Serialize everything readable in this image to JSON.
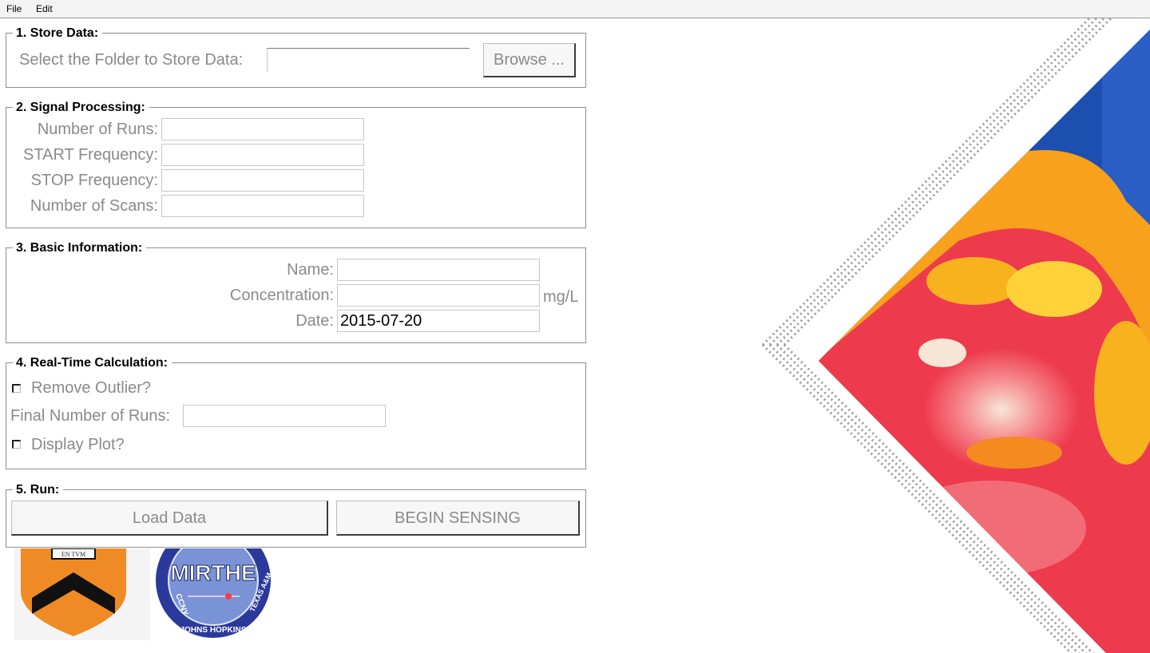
{
  "menu": {
    "file": "File",
    "edit": "Edit"
  },
  "store": {
    "legend": "1. Store Data:",
    "folder_label": "Select the Folder to Store Data:",
    "folder_value": "",
    "browse_label": "Browse ..."
  },
  "signal": {
    "legend": "2. Signal Processing:",
    "runs_label": "Number of Runs:",
    "start_label": "START Frequency:",
    "stop_label": "STOP Frequency:",
    "scans_label": "Number of Scans:",
    "runs_value": "",
    "start_value": "",
    "stop_value": "",
    "scans_value": ""
  },
  "basic": {
    "legend": "3. Basic Information:",
    "name_label": "Name:",
    "conc_label": "Concentration:",
    "date_label": "Date:",
    "name_value": "",
    "conc_value": "",
    "date_value": "2015-07-20",
    "unit": "mg/L"
  },
  "realtime": {
    "legend": "4. Real-Time Calculation:",
    "outlier_label": "Remove Outlier?",
    "final_runs_label": "Final Number of Runs:",
    "final_runs_value": "",
    "plot_label": "Display Plot?"
  },
  "run": {
    "legend": "5. Run:",
    "load_label": "Load Data",
    "begin_label": "BEGIN SENSING"
  },
  "logos": {
    "shield_ribbon": "EN TVM",
    "mirthe_text": "MIRTHE",
    "mirthe_ring_left": "CCNY",
    "mirthe_ring_bottom": "JOHNS HOPKINS",
    "mirthe_ring_right": "TEXAS A&M"
  },
  "colors": {
    "princeton_orange": "#f08a24",
    "mirthe_blue": "#2b3a9a",
    "label_gray": "#8a8a8a"
  }
}
